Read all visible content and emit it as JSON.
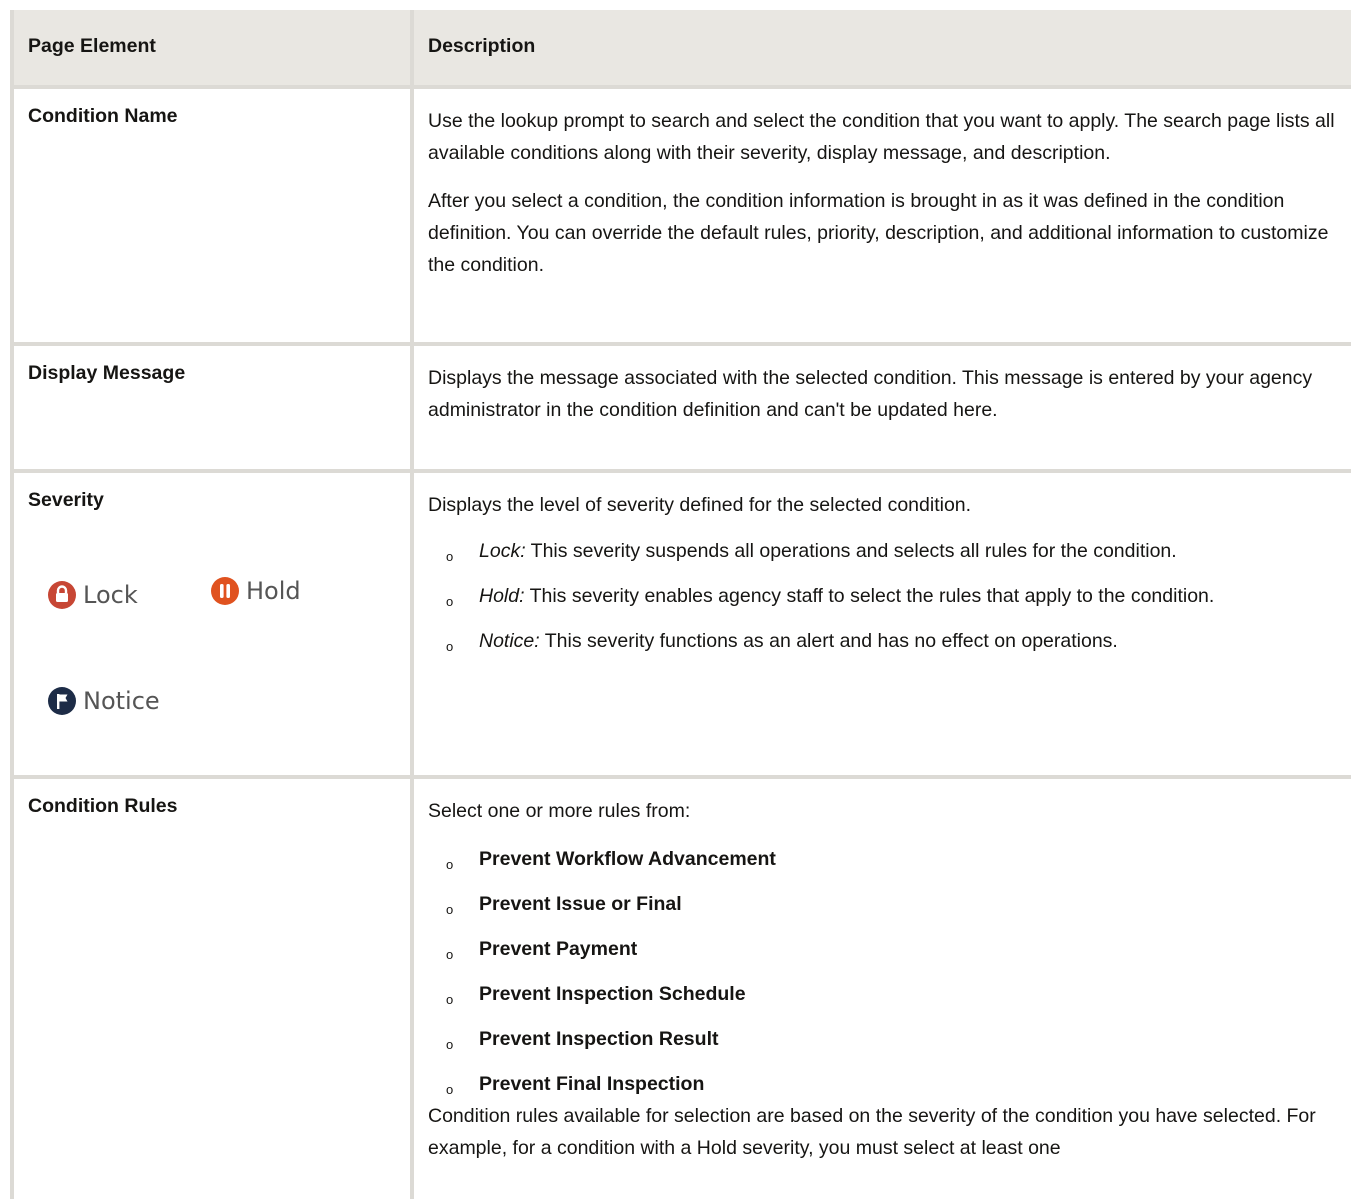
{
  "header": {
    "col1": "Page Element",
    "col2": "Description"
  },
  "rows": {
    "condition_name": {
      "label": "Condition Name",
      "p1": "Use the lookup prompt to search and select the condition that you want to apply. The search page lists all available conditions along with their severity, display message, and description.",
      "p2": "After you select a condition, the condition information is brought in as it was defined in the condition definition. You can override the default rules, priority, description, and additional information to customize the condition."
    },
    "display_message": {
      "label": "Display Message",
      "p1": "Displays the message associated with the selected condition. This message is entered by your agency administrator in the condition definition and can't be updated here."
    },
    "severity": {
      "label": "Severity",
      "icons": {
        "lock": "Lock",
        "hold": "Hold",
        "notice": "Notice",
        "lock_color": "#c74634",
        "hold_color": "#e0521f",
        "notice_color": "#1d2c47"
      },
      "intro": "Displays the level of severity defined for the selected condition.",
      "items": [
        {
          "term": "Lock:",
          "text": " This severity suspends all operations and selects all rules for the condition."
        },
        {
          "term": "Hold:",
          "text": " This severity enables agency staff to select the rules that apply to the condition."
        },
        {
          "term": "Notice:",
          "text": " This severity functions as an alert and has no effect on operations."
        }
      ]
    },
    "condition_rules": {
      "label": "Condition Rules",
      "intro": "Select one or more rules from:",
      "items": [
        "Prevent Workflow Advancement",
        "Prevent Issue or Final",
        "Prevent Payment",
        "Prevent Inspection Schedule",
        "Prevent Inspection Result",
        "Prevent Final Inspection"
      ],
      "outro": "Condition rules available for selection are based on the severity of the condition you have selected. For example, for a condition with a Hold severity, you must select at least one"
    }
  },
  "bullet_glyph": "o"
}
